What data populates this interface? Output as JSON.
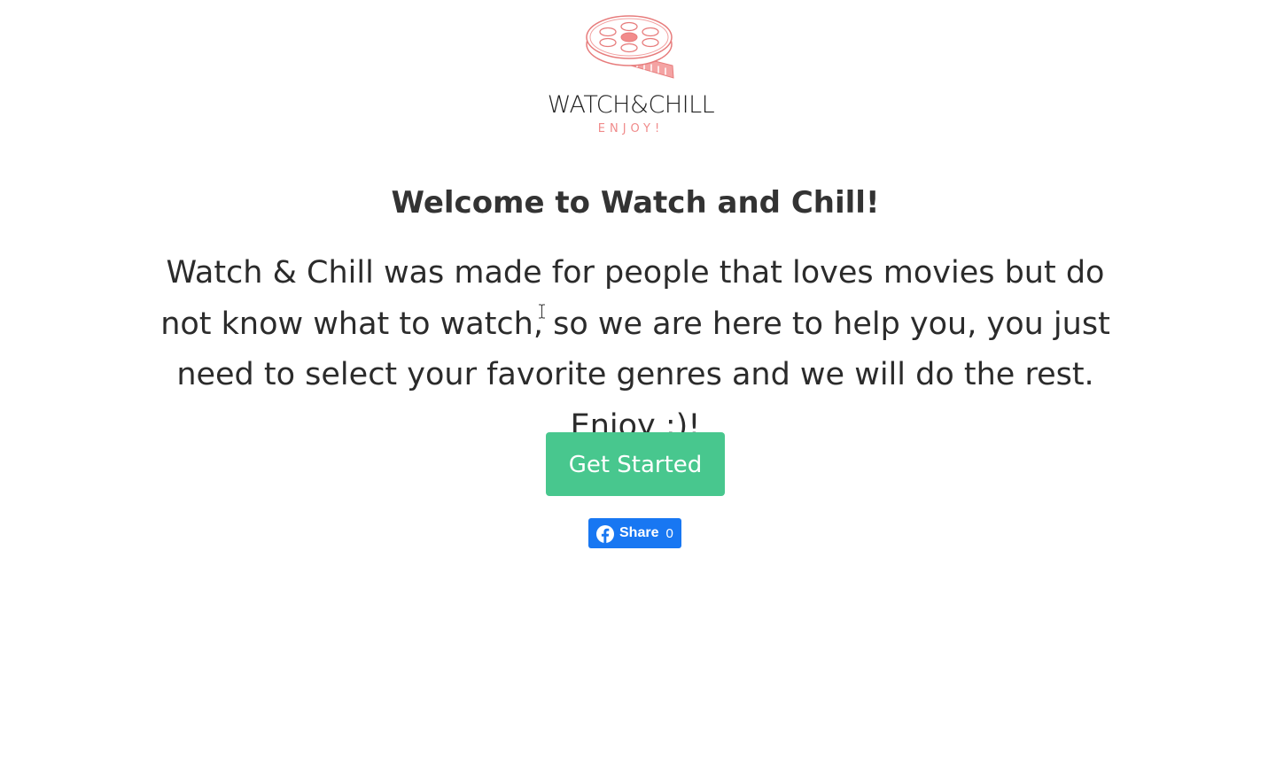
{
  "logo": {
    "icon": "film-reel-icon",
    "wordmark": "WATCH&CHILL",
    "tagline": "ENJOY!",
    "accent_color": "#f08b8b"
  },
  "hero": {
    "title": "Welcome to Watch and Chill!",
    "description": "Watch & Chill was made for people that loves movies but do not know what to watch, so we are here to help you, you just need to select your favorite genres and we will do the rest. Enjoy ;)!"
  },
  "cta": {
    "label": "Get Started",
    "color": "#48c78e"
  },
  "share": {
    "icon": "facebook-icon",
    "label": "Share",
    "count": "0",
    "color": "#1877f2"
  }
}
